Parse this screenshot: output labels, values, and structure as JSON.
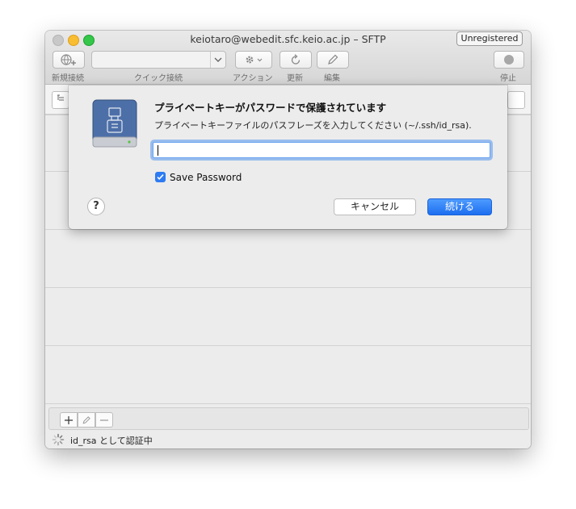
{
  "window": {
    "title": "keiotaro@webedit.sfc.keio.ac.jp – SFTP",
    "unregistered_label": "Unregistered"
  },
  "toolbar": {
    "new_connection_label": "新規接続",
    "quick_connect_label": "クイック接続",
    "action_label": "アクション",
    "refresh_label": "更新",
    "edit_label": "編集",
    "stop_label": "停止"
  },
  "dialog": {
    "title": "プライベートキーがパスワードで保護されています",
    "message": "プライベートキーファイルのパスフレーズを入力してください (~/.ssh/id_rsa).",
    "password_value": "",
    "save_password_label": "Save Password",
    "save_password_checked": true,
    "help_label": "?",
    "cancel_label": "キャンセル",
    "continue_label": "続ける"
  },
  "status": {
    "text": "id_rsa として認証中"
  },
  "colors": {
    "accent": "#2d7bf3",
    "drive_icon": "#4d6fa8"
  }
}
